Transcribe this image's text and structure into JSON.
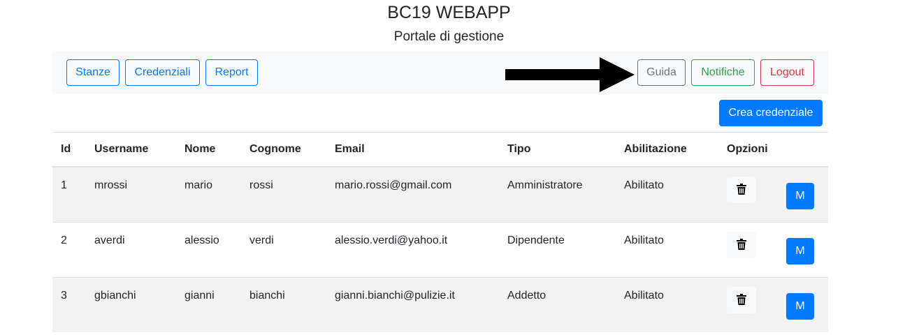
{
  "header": {
    "title": "BC19 WEBAPP",
    "subtitle": "Portale di gestione"
  },
  "nav": {
    "left": [
      "Stanze",
      "Credenziali",
      "Report"
    ],
    "guida": "Guida",
    "notifiche": "Notifiche",
    "logout": "Logout"
  },
  "actions": {
    "create_label": "Crea credenziale"
  },
  "table": {
    "columns": [
      "Id",
      "Username",
      "Nome",
      "Cognome",
      "Email",
      "Tipo",
      "Abilitazione",
      "Opzioni"
    ],
    "rows": [
      {
        "id": "1",
        "username": "mrossi",
        "nome": "mario",
        "cognome": "rossi",
        "email": "mario.rossi@gmail.com",
        "tipo": "Amministratore",
        "abilitazione": "Abilitato",
        "modify_label": "M"
      },
      {
        "id": "2",
        "username": "averdi",
        "nome": "alessio",
        "cognome": "verdi",
        "email": "alessio.verdi@yahoo.it",
        "tipo": "Dipendente",
        "abilitazione": "Abilitato",
        "modify_label": "M"
      },
      {
        "id": "3",
        "username": "gbianchi",
        "nome": "gianni",
        "cognome": "bianchi",
        "email": "gianni.bianchi@pulizie.it",
        "tipo": "Addetto",
        "abilitazione": "Abilitato",
        "modify_label": "M"
      }
    ]
  },
  "icons": {
    "delete": "trash-icon",
    "annotation": "arrow-right-icon"
  },
  "colors": {
    "primary": "#007bff",
    "secondary": "#6c757d",
    "success": "#28a745",
    "danger": "#dc3545",
    "navbar_bg": "#f8f9fa",
    "stripe_bg": "#f2f2f2"
  }
}
